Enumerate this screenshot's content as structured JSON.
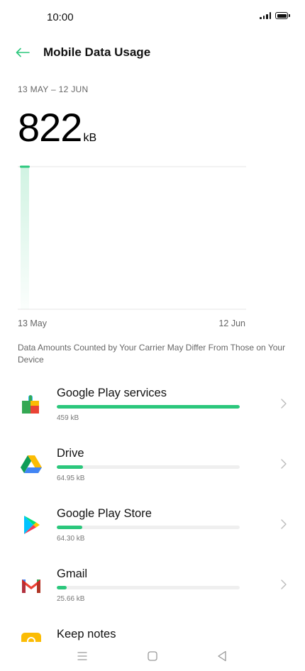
{
  "status_bar": {
    "time": "10:00"
  },
  "header": {
    "title": "Mobile Data Usage"
  },
  "summary": {
    "date_range": "13 MAY – 12 JUN",
    "total_value": "822",
    "total_unit": "kB"
  },
  "chart": {
    "axis_start": "13 May",
    "axis_end": "12 Jun"
  },
  "chart_data": {
    "type": "bar",
    "categories": [
      "13 May",
      "12 Jun"
    ],
    "values": [
      822,
      0
    ],
    "xlabel": "",
    "ylabel": "",
    "grid": false
  },
  "disclaimer": "Data Amounts Counted by Your Carrier May Differ From Those on Your Device",
  "apps": [
    {
      "name": "Google Play services",
      "size": "459 kB",
      "fraction": 1.0,
      "icon": "google-play-services-icon"
    },
    {
      "name": "Drive",
      "size": "64.95 kB",
      "fraction": 0.1415,
      "icon": "google-drive-icon"
    },
    {
      "name": "Google Play Store",
      "size": "64.30 kB",
      "fraction": 0.1401,
      "icon": "google-play-store-icon"
    },
    {
      "name": "Gmail",
      "size": "25.66 kB",
      "fraction": 0.0559,
      "icon": "gmail-icon"
    },
    {
      "name": "Keep notes",
      "size": "",
      "fraction": 0,
      "icon": "keep-notes-icon"
    }
  ],
  "colors": {
    "accent": "#2bc77c",
    "back_arrow": "#2bc77c"
  }
}
